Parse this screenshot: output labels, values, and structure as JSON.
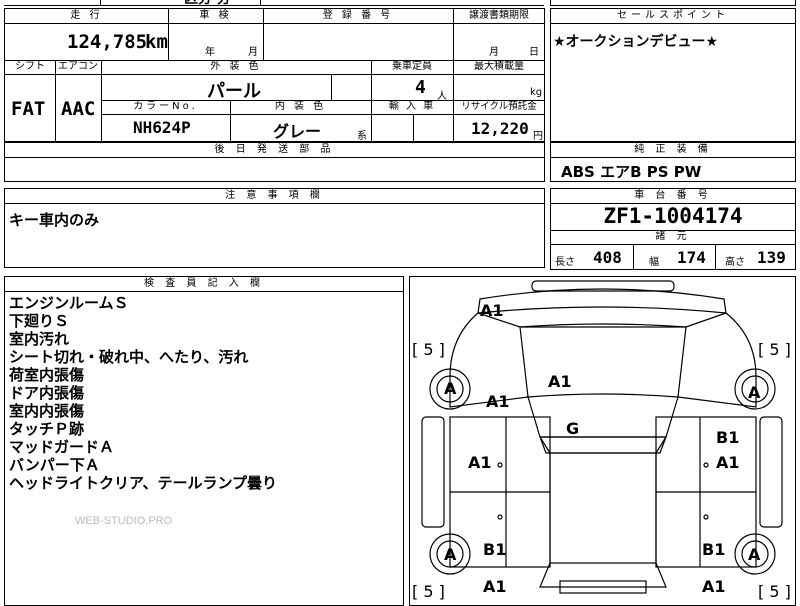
{
  "header_top": {
    "partial_text": "区分 分"
  },
  "mileage": {
    "label": "走 行",
    "value": "124,785",
    "unit": "km"
  },
  "inspection": {
    "label": "車 検",
    "year_unit": "年",
    "month_unit": "月"
  },
  "registration": {
    "label": "登 録 番 号"
  },
  "transfer_deadline": {
    "label": "譲渡書類期限",
    "month_unit": "月",
    "day_unit": "日"
  },
  "sales_point": {
    "label": "セールスポイント",
    "text": "★オークションデビュー★"
  },
  "shift": {
    "label": "シフト",
    "value": "FAT"
  },
  "aircon": {
    "label": "エアコン",
    "value": "AAC"
  },
  "exterior_color": {
    "label": "外 装 色",
    "value": "パール"
  },
  "capacity": {
    "label": "乗車定員",
    "value": "4",
    "unit": "人"
  },
  "max_load": {
    "label": "最大積載量",
    "unit": "kg"
  },
  "color_no": {
    "label": "カラーNo.",
    "value": "NH624P"
  },
  "interior_color": {
    "label": "内 装 色",
    "value": "グレー",
    "suffix": "系"
  },
  "import_car": {
    "label": "輸 入 車"
  },
  "recycle_fee": {
    "label": "リサイクル預託金",
    "value": "12,220",
    "unit": "円"
  },
  "delivery_parts": {
    "label": "後 日 発 送 部 品"
  },
  "genuine_equipment": {
    "label": "純 正 装 備",
    "value": "ABS エアB PS PW"
  },
  "caution": {
    "label": "注 意 事 項 欄",
    "text": "キー車内のみ"
  },
  "chassis": {
    "label": "車 台 番 号",
    "value": "ZF1-1004174"
  },
  "dimensions": {
    "label": "諸 元",
    "length_label": "長さ",
    "length": "408",
    "width_label": "幅",
    "width": "174",
    "height_label": "高さ",
    "height": "139"
  },
  "inspector": {
    "label": "検 査 員 記 入 欄",
    "lines": [
      "エンジンルームＳ",
      "下廻りＳ",
      "室内汚れ",
      "シート切れ・破れ中、へたり、汚れ",
      "荷室内張傷",
      "ドア内張傷",
      "室内内張傷",
      "タッチＰ跡",
      "マッドガードＡ",
      "バンパー下Ａ",
      "ヘッドライトクリア、テールランプ曇り"
    ]
  },
  "watermark": "WEB-STUDIO.PRO",
  "diagram_marks": {
    "front_bumper": "A1",
    "hood": "A1",
    "left_front_fender": "A1",
    "roof": "G",
    "left_front_door": "A1",
    "right_front_door_top": "B1",
    "right_front_door": "A1",
    "left_rear_quarter": "B1",
    "right_rear_quarter": "B1",
    "left_rear_bottom": "A1",
    "right_rear_bottom": "A1",
    "front_left_wheel": "A",
    "front_right_wheel": "A",
    "rear_left_wheel": "A",
    "rear_right_wheel": "A",
    "tire_fl": "[ 5 ]",
    "tire_fr": "[ 5 ]",
    "tire_rl": "[ 5 ]",
    "tire_rr": "[ 5 ]"
  }
}
